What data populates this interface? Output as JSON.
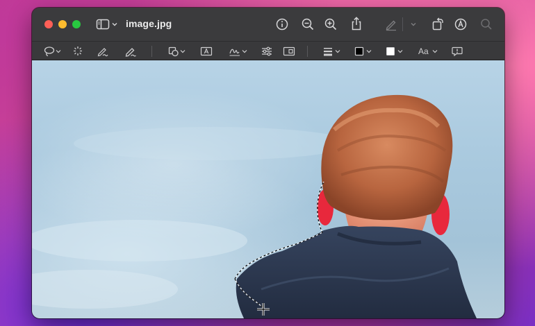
{
  "window": {
    "title": "image.jpg"
  },
  "toolbar": {
    "icons": [
      "sidebar-icon",
      "chevron-down-icon",
      "info-icon",
      "zoom-out-icon",
      "zoom-in-icon",
      "share-icon",
      "highlight-icon",
      "rotate-icon",
      "markup-icon",
      "search-icon"
    ]
  },
  "markup": {
    "text_style_label": "Aa",
    "colors": {
      "border_color": "#000000",
      "fill_color": "#ffffff"
    }
  },
  "colors": {
    "titlebar": "#3b3b3d",
    "markupbar": "#39393b",
    "traffic_close": "#fe5f57",
    "traffic_min": "#febc2e",
    "traffic_max": "#28c840"
  }
}
